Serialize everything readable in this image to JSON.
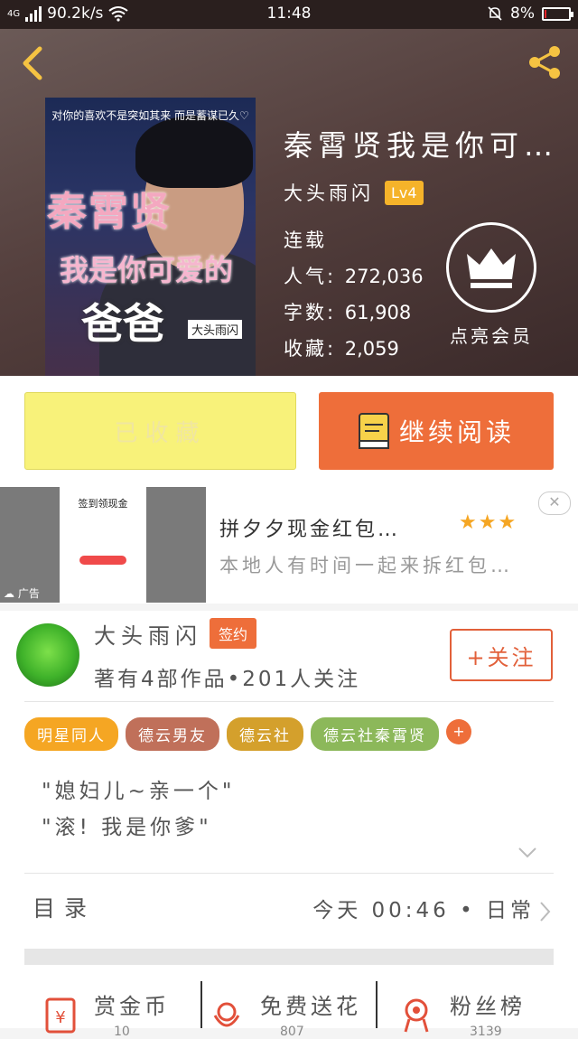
{
  "status_bar": {
    "network": "4G",
    "speed": "90.2k/s",
    "time": "11:48",
    "battery": "8%",
    "battery_level": 0.08,
    "battery_color": "#e8242a"
  },
  "header": {
    "back_icon": "chevron-left-icon",
    "share_icon": "share-icon"
  },
  "book": {
    "title": "秦霄贤我是你可…",
    "author": "大头雨闪",
    "level": "Lv4",
    "status": "连载",
    "popularity_label": "人气:",
    "popularity": "272,036",
    "words_label": "字数:",
    "words": "61,908",
    "favorites_label": "收藏:",
    "favorites": "2,059",
    "vip_label": "点亮会员",
    "cover": {
      "top_text": "对你的喜欢不是突如其来 而是蓄谋已久♡",
      "title_line1": "秦霄贤",
      "title_line2": "我是你可爱的",
      "title_line3": "爸爸",
      "author_tag": "大头雨闪"
    }
  },
  "actions": {
    "favorited_label": "已收藏",
    "continue_label": "继续阅读"
  },
  "ad": {
    "title": "拼夕夕现金红包…",
    "stars": "★★★",
    "subtitle": "本地人有时间一起来拆红包…",
    "image_heading": "签到领现金",
    "ad_tag": "广告",
    "close": "✕"
  },
  "writer": {
    "name": "大头雨闪",
    "signed_label": "签约",
    "stats": "著有4部作品•201人关注",
    "follow_label": "+关注"
  },
  "tags": [
    {
      "label": "明星同人",
      "color": "#f5a623"
    },
    {
      "label": "德云男友",
      "color": "#c0705a"
    },
    {
      "label": "德云社",
      "color": "#d4a02c"
    },
    {
      "label": "德云社秦霄贤",
      "color": "#8cb85a"
    }
  ],
  "tags_more": "+",
  "intro": {
    "line1": "\"媳妇儿~亲一个\"",
    "line2": "\"滚! 我是你爹\""
  },
  "toc": {
    "label": "目录",
    "update": "今天 00:46 • 日常"
  },
  "features": [
    {
      "label": "赏金币",
      "icon": "coin-icon",
      "value": "10"
    },
    {
      "label": "免费送花",
      "icon": "flower-icon",
      "value": "807"
    },
    {
      "label": "粉丝榜",
      "icon": "medal-icon",
      "value": "3139"
    }
  ],
  "colors": {
    "accent": "#ee6e3a",
    "favorite_bg": "#f8f27a",
    "level_badge": "#f5b32a"
  }
}
